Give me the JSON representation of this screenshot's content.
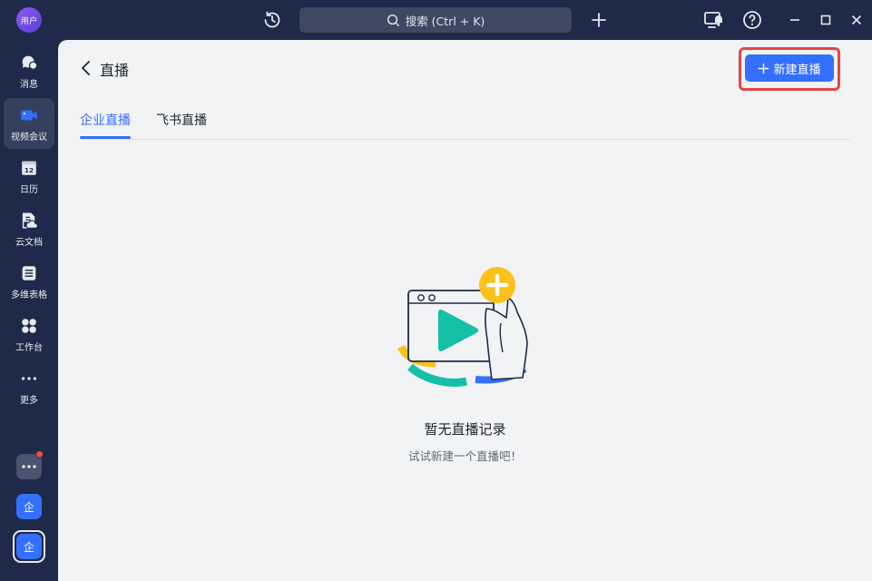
{
  "titlebar": {
    "avatar_label": "用户",
    "search_placeholder": "搜索 (Ctrl + K)"
  },
  "sidebar": {
    "items": [
      {
        "label": "消息",
        "icon": "chat-bubble-icon"
      },
      {
        "label": "视频会议",
        "icon": "video-camera-icon"
      },
      {
        "label": "日历",
        "icon": "calendar-icon",
        "day": "12"
      },
      {
        "label": "云文档",
        "icon": "cloud-doc-icon"
      },
      {
        "label": "多维表格",
        "icon": "table-icon"
      },
      {
        "label": "工作台",
        "icon": "grid-apps-icon"
      },
      {
        "label": "更多",
        "icon": "more-dots-icon"
      }
    ],
    "bottom": {
      "org1_label": "企",
      "org2_label": "企"
    }
  },
  "header": {
    "title": "直播",
    "new_button_label": "新建直播"
  },
  "tabs": [
    {
      "label": "企业直播",
      "active": true
    },
    {
      "label": "飞书直播",
      "active": false
    }
  ],
  "empty_state": {
    "title": "暂无直播记录",
    "subtitle": "试试新建一个直播吧！"
  },
  "colors": {
    "accent": "#3370ff",
    "sidebar_bg": "#1f2a4a",
    "highlight_frame": "#e54545",
    "illus_green": "#14c0a6",
    "illus_yellow": "#fcc11a"
  }
}
